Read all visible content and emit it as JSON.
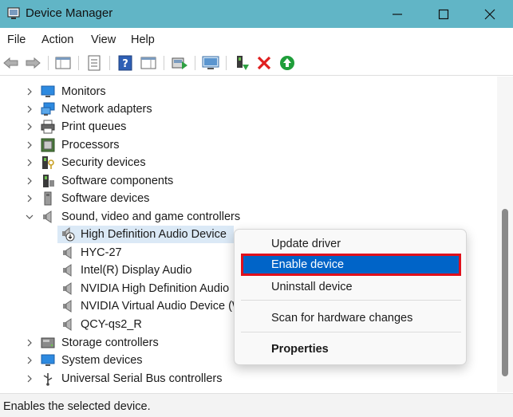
{
  "window": {
    "title": "Device Manager",
    "accent": "#61b5c6",
    "controls": [
      "minimize-icon",
      "maximize-icon",
      "close-icon"
    ]
  },
  "menu": [
    "File",
    "Action",
    "View",
    "Help"
  ],
  "toolbar": [
    "back-icon",
    "forward-icon",
    "tree-view-icon",
    "properties-icon",
    "help-icon",
    "action-pane-icon",
    "update-driver-icon",
    "scan-hardware-icon",
    "enable-device-icon",
    "uninstall-device-icon",
    "disable-device-icon"
  ],
  "tree": {
    "categories_above": [
      {
        "label": "Monitors",
        "icon": "monitor-icon"
      },
      {
        "label": "Network adapters",
        "icon": "network-icon"
      },
      {
        "label": "Print queues",
        "icon": "printer-icon"
      },
      {
        "label": "Processors",
        "icon": "processor-icon"
      },
      {
        "label": "Security devices",
        "icon": "security-icon"
      },
      {
        "label": "Software components",
        "icon": "software-component-icon"
      },
      {
        "label": "Software devices",
        "icon": "software-device-icon"
      }
    ],
    "expanded": {
      "label": "Sound, video and game controllers",
      "icon": "speaker-icon"
    },
    "children": [
      {
        "label": "High Definition Audio Device",
        "icon": "disabled-speaker-icon",
        "selected": true
      },
      {
        "label": "HYC-27",
        "icon": "speaker-icon"
      },
      {
        "label": "Intel(R) Display Audio",
        "icon": "speaker-icon"
      },
      {
        "label": "NVIDIA High Definition Audio",
        "icon": "speaker-icon"
      },
      {
        "label": "NVIDIA Virtual Audio Device (W",
        "icon": "speaker-icon"
      },
      {
        "label": "QCY-qs2_R",
        "icon": "speaker-icon"
      }
    ],
    "categories_below": [
      {
        "label": "Storage controllers",
        "icon": "storage-icon"
      },
      {
        "label": "System devices",
        "icon": "system-icon"
      },
      {
        "label": "Universal Serial Bus controllers",
        "icon": "usb-icon"
      }
    ]
  },
  "context_menu": {
    "update": "Update driver",
    "enable": "Enable device",
    "uninstall": "Uninstall device",
    "scan": "Scan for hardware changes",
    "properties": "Properties",
    "highlight_color": "#0064c8",
    "outline_color": "#e0101c"
  },
  "status": "Enables the selected device."
}
